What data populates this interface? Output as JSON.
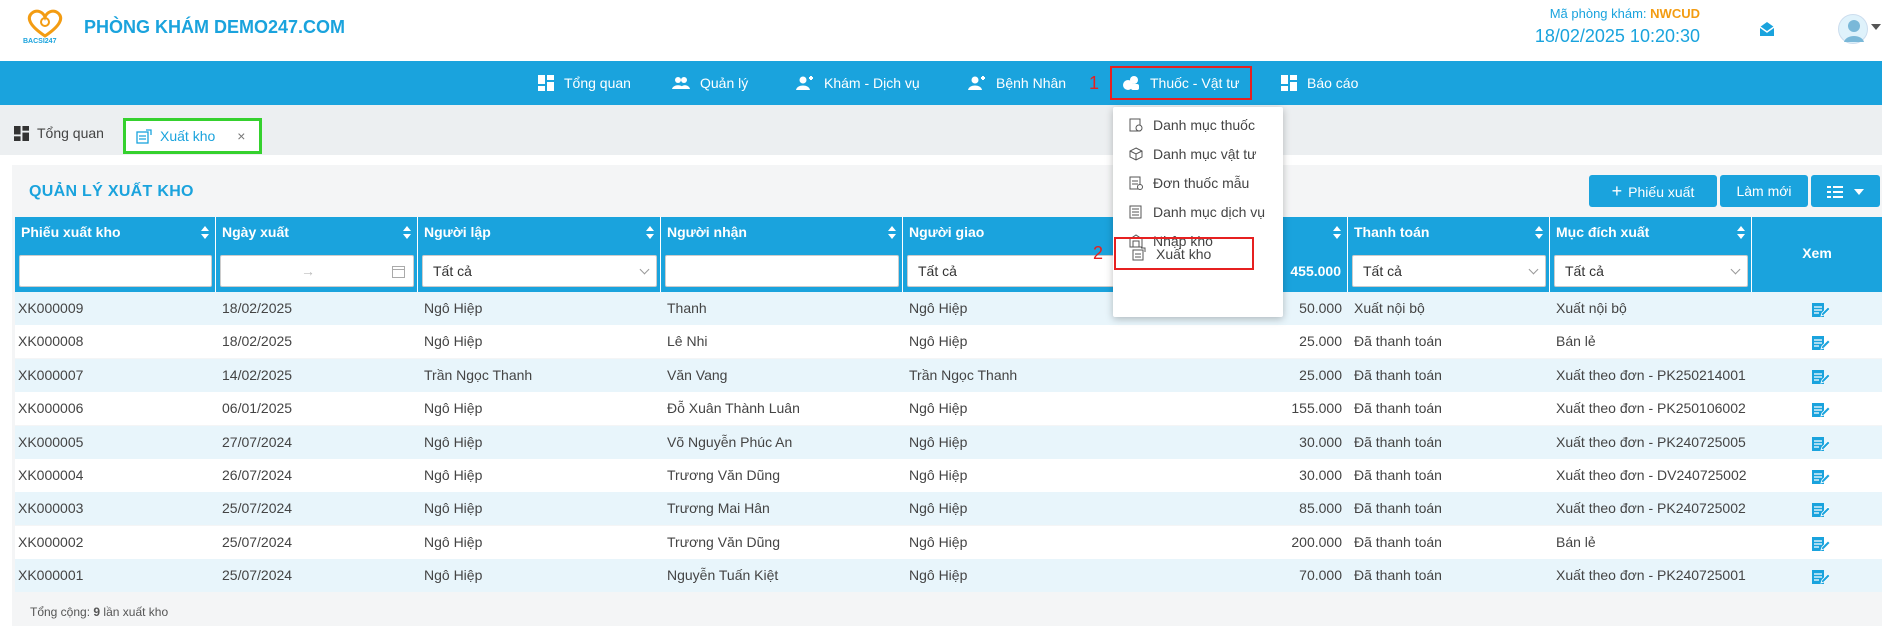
{
  "header": {
    "clinic_name": "PHÒNG KHÁM DEMO247.COM",
    "logo_text": "BACSI247",
    "clinic_code_label": "Mã phòng khám:",
    "clinic_code": "NWCUD",
    "datetime": "18/02/2025 10:20:30"
  },
  "nav": [
    {
      "label": "Tổng quan",
      "icon": "dashboard-icon"
    },
    {
      "label": "Quản lý",
      "icon": "users-icon"
    },
    {
      "label": "Khám - Dịch vụ",
      "icon": "exam-icon"
    },
    {
      "label": "Bệnh Nhân",
      "icon": "patient-icon"
    },
    {
      "label": "Thuốc - Vật tư",
      "icon": "medicine-icon"
    },
    {
      "label": "Báo cáo",
      "icon": "report-icon"
    }
  ],
  "annotations": {
    "step1": "1",
    "step2": "2"
  },
  "tabs": [
    {
      "label": "Tổng quan"
    },
    {
      "label": "Xuất kho",
      "close": "×"
    }
  ],
  "page": {
    "title": "QUẢN LÝ XUẤT KHO",
    "btn_create": "Phiếu xuất",
    "btn_refresh": "Làm mới"
  },
  "table": {
    "columns": [
      "Phiếu xuất kho",
      "Ngày xuất",
      "Người lập",
      "Người nhận",
      "Người giao",
      "",
      "Thanh toán",
      "Mục đích xuất",
      "Xem"
    ],
    "filters": {
      "nguoi_lap": "Tất cả",
      "nguoi_giao": "Tất cả",
      "tong_tien": "455.000",
      "thanh_toan": "Tất cả",
      "muc_dich": "Tất cả",
      "date_arrow": "→"
    },
    "rows": [
      {
        "code": "XK000009",
        "date": "18/02/2025",
        "creator": "Ngô Hiệp",
        "receiver": "Thanh",
        "giver": "Ngô Hiệp",
        "amount": "50.000",
        "payment": "Xuất nội bộ",
        "purpose": "Xuất nội bộ"
      },
      {
        "code": "XK000008",
        "date": "18/02/2025",
        "creator": "Ngô Hiệp",
        "receiver": "Lê Nhi",
        "giver": "Ngô Hiệp",
        "amount": "25.000",
        "payment": "Đã thanh toán",
        "purpose": "Bán lẻ"
      },
      {
        "code": "XK000007",
        "date": "14/02/2025",
        "creator": "Trần Ngọc Thanh",
        "receiver": "Văn Vang",
        "giver": "Trần Ngọc Thanh",
        "amount": "25.000",
        "payment": "Đã thanh toán",
        "purpose": "Xuất theo đơn - PK250214001"
      },
      {
        "code": "XK000006",
        "date": "06/01/2025",
        "creator": "Ngô Hiệp",
        "receiver": "Đỗ Xuân Thành Luân",
        "giver": "Ngô Hiệp",
        "amount": "155.000",
        "payment": "Đã thanh toán",
        "purpose": "Xuất theo đơn - PK250106002"
      },
      {
        "code": "XK000005",
        "date": "27/07/2024",
        "creator": "Ngô Hiệp",
        "receiver": "Võ Nguyễn Phúc An",
        "giver": "Ngô Hiệp",
        "amount": "30.000",
        "payment": "Đã thanh toán",
        "purpose": "Xuất theo đơn - PK240725005"
      },
      {
        "code": "XK000004",
        "date": "26/07/2024",
        "creator": "Ngô Hiệp",
        "receiver": "Trương Văn Dũng",
        "giver": "Ngô Hiệp",
        "amount": "30.000",
        "payment": "Đã thanh toán",
        "purpose": "Xuất theo đơn - DV240725002"
      },
      {
        "code": "XK000003",
        "date": "25/07/2024",
        "creator": "Ngô Hiệp",
        "receiver": "Trương Mai Hân",
        "giver": "Ngô Hiệp",
        "amount": "85.000",
        "payment": "Đã thanh toán",
        "purpose": "Xuất theo đơn - PK240725002"
      },
      {
        "code": "XK000002",
        "date": "25/07/2024",
        "creator": "Ngô Hiệp",
        "receiver": "Trương Văn Dũng",
        "giver": "Ngô Hiệp",
        "amount": "200.000",
        "payment": "Đã thanh toán",
        "purpose": "Bán lẻ"
      },
      {
        "code": "XK000001",
        "date": "25/07/2024",
        "creator": "Ngô Hiệp",
        "receiver": "Nguyễn Tuấn Kiệt",
        "giver": "Ngô Hiệp",
        "amount": "70.000",
        "payment": "Đã thanh toán",
        "purpose": "Xuất theo đơn - PK240725001"
      }
    ]
  },
  "footer": {
    "prefix": "Tổng cộng:",
    "count": "9",
    "suffix": "lần xuất kho"
  },
  "dropdown": [
    "Danh mục thuốc",
    "Danh mục vật tư",
    "Đơn thuốc mẫu",
    "Danh mục dịch vụ",
    "Nhập kho",
    "Xuất kho"
  ],
  "colors": {
    "primary": "#1aa3dd",
    "highlight_red": "#e62020",
    "highlight_green": "#35d12e",
    "accent_orange": "#f39c12"
  }
}
